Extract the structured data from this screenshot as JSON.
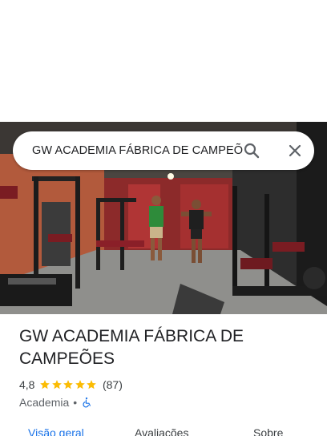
{
  "search": {
    "query": "GW ACADEMIA FÁBRICA DE CAMPEÕES"
  },
  "place": {
    "name": "GW ACADEMIA FÁBRICA DE CAMPEÕES",
    "rating": "4,8",
    "star_count": 5,
    "reviews": "(87)",
    "category": "Academia",
    "separator": "•",
    "accessibility_icon": "wheelchair-icon"
  },
  "tabs": [
    {
      "label": "Visão geral",
      "active": true
    },
    {
      "label": "Avaliações",
      "active": false
    },
    {
      "label": "Sobre",
      "active": false
    }
  ],
  "colors": {
    "accent": "#1a73e8",
    "star": "#fbbc04",
    "text_primary": "#202124",
    "text_secondary": "#5f6368"
  }
}
